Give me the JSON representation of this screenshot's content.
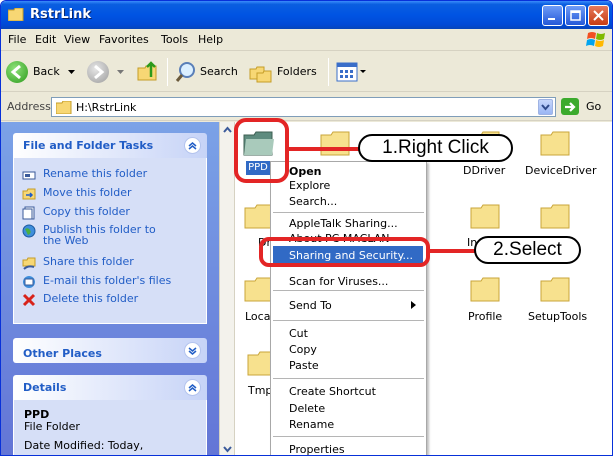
{
  "window": {
    "title": "RstrLink"
  },
  "menubar": {
    "items": [
      "File",
      "Edit",
      "View",
      "Favorites",
      "Tools",
      "Help"
    ]
  },
  "toolbar": {
    "back_label": "Back",
    "search_label": "Search",
    "folders_label": "Folders"
  },
  "address": {
    "label": "Address",
    "value": "H:\\RstrLink",
    "go_label": "Go"
  },
  "taskpane": {
    "file_folder_tasks": {
      "title": "File and Folder Tasks",
      "items": [
        "Rename this folder",
        "Move this folder",
        "Copy this folder",
        "Publish this folder to",
        "the Web",
        "Share this folder",
        "E-mail this folder's files",
        "Delete this folder"
      ]
    },
    "other_places": {
      "title": "Other Places"
    },
    "details": {
      "title": "Details",
      "name": "PPD",
      "type": "File Folder",
      "modified": "Date Modified: Today,"
    }
  },
  "folders": {
    "selected": "PPD",
    "items": [
      "DDriver",
      "DeviceDriver",
      "Dri",
      "In",
      "Localiz",
      "Profile",
      "SetupTools",
      "Tmp"
    ]
  },
  "context_menu": {
    "items": [
      "Open",
      "Explore",
      "Search...",
      "AppleTalk Sharing...",
      "About PC MACLAN",
      "Sharing and Security...",
      "Scan for Viruses...",
      "Send To",
      "Cut",
      "Copy",
      "Paste",
      "Create Shortcut",
      "Delete",
      "Rename",
      "Properties"
    ]
  },
  "annotations": {
    "step1": "1.Right Click",
    "step2": "2.Select",
    "color": "#e32525"
  }
}
